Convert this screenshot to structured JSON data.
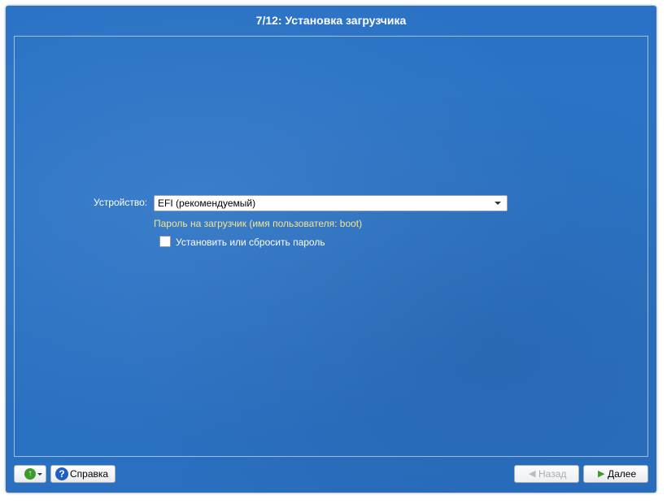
{
  "window": {
    "title": "7/12: Установка загрузчика"
  },
  "form": {
    "device_label": "Устройство:",
    "device_value": "EFI (рекомендуемый)",
    "password_hint": "Пароль на загрузчик (имя пользователя: boot)",
    "checkbox_label": "Установить или сбросить пароль",
    "checkbox_checked": false
  },
  "footer": {
    "up_icon": "up-arrow-icon",
    "help_label": "Справка",
    "help_icon": "question-icon",
    "back_label": "Назад",
    "back_enabled": false,
    "next_label": "Далее"
  },
  "colors": {
    "background": "#2a72c5",
    "hint_text": "#f5e58c",
    "accent_green": "#3d9a2d"
  }
}
